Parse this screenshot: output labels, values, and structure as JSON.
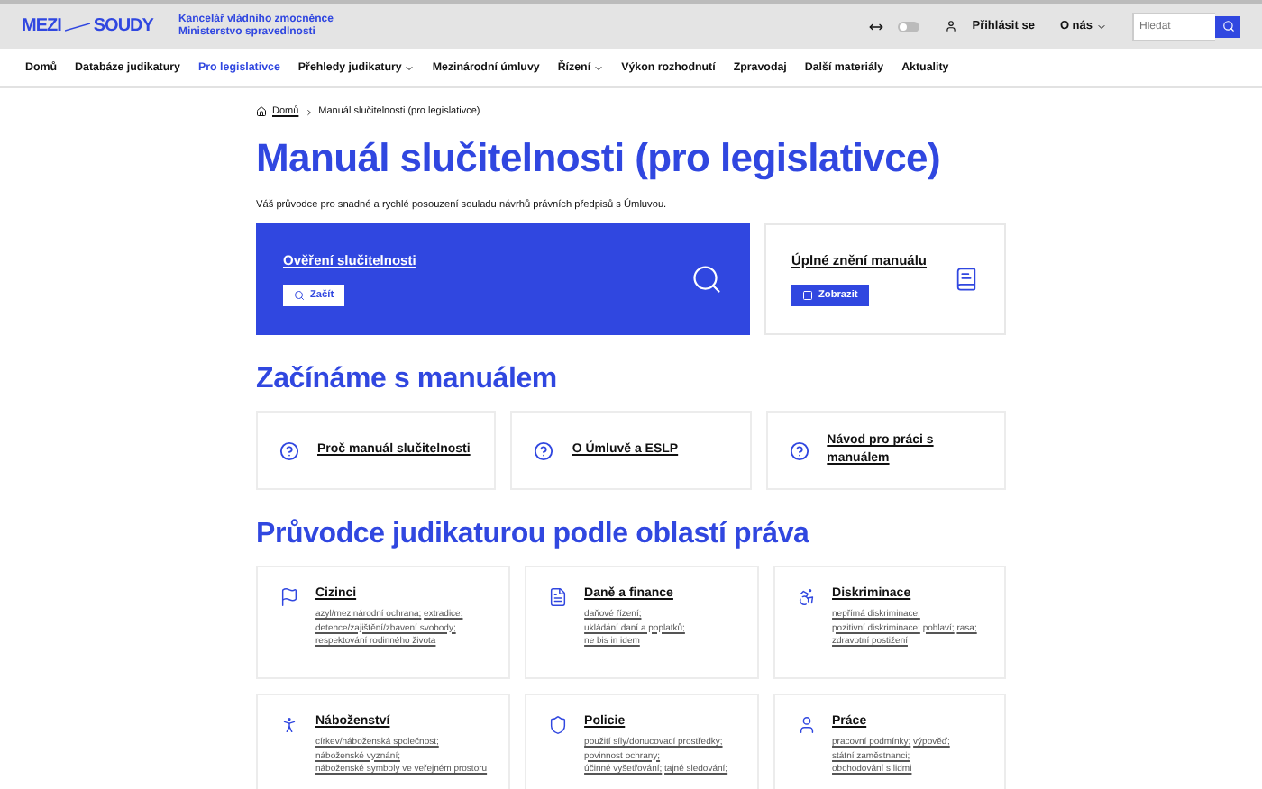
{
  "header": {
    "logo_left": "MEZI",
    "logo_right": "SOUDY",
    "org_lines": [
      "Kancelář vládního zmocněnce",
      "Ministerstvo spravedlnosti"
    ],
    "contrast_toggle": {
      "on": false
    },
    "login": "Přihlásit se",
    "about": "O nás",
    "search": {
      "placeholder": "Hledat"
    }
  },
  "nav": [
    {
      "label": "Domů",
      "selected": false,
      "has_menu": false
    },
    {
      "label": "Databáze judikatury",
      "selected": false,
      "has_menu": false
    },
    {
      "label": "Pro legislativce",
      "selected": true,
      "has_menu": false
    },
    {
      "label": "Přehledy judikatury",
      "selected": false,
      "has_menu": true
    },
    {
      "label": "Mezinárodní úmluvy",
      "selected": false,
      "has_menu": false
    },
    {
      "label": "Řízení",
      "selected": false,
      "has_menu": true
    },
    {
      "label": "Výkon rozhodnutí",
      "selected": false,
      "has_menu": false
    },
    {
      "label": "Zpravodaj",
      "selected": false,
      "has_menu": false
    },
    {
      "label": "Další materiály",
      "selected": false,
      "has_menu": false
    },
    {
      "label": "Aktuality",
      "selected": false,
      "has_menu": false
    }
  ],
  "breadcrumb": [
    "Domů",
    "Manuál slučitelnosti (pro legislativce)"
  ],
  "title": "Manuál slučitelnosti (pro legislativce)",
  "intro": "Váš průvodce pro snadné a rychlé posouzení souladu návrhů právních předpisů s Úmluvou.",
  "hero_cards": [
    {
      "kind": "primary",
      "title": "Ověření slučitelnosti",
      "button": "Začít"
    },
    {
      "kind": "secondary",
      "title": "Úplné znění manuálu",
      "button": "Zobrazit"
    }
  ],
  "start_heading": "Začínáme s manuálem",
  "start_links": [
    "Proč manuál slučitelnosti",
    "O Úmluvě a ESLP",
    "Návod pro práci s manuálem"
  ],
  "guide_heading": "Průvodce judikaturou podle oblastí práva",
  "topics": [
    {
      "title": "Cizinci",
      "links": [
        "azyl/mezinárodní ochrana;",
        "extradice;",
        "detence/zajištění/zbavení svobody;",
        "respektování rodinného života"
      ]
    },
    {
      "title": "Daně a finance",
      "links": [
        "daňové řízení;",
        "ukládání daní a poplatků;",
        "ne bis in idem"
      ]
    },
    {
      "title": "Diskriminace",
      "links": [
        "nepřímá diskriminace;",
        "pozitivní diskriminace;",
        "pohlaví;",
        "rasa;",
        "zdravotní postižení"
      ]
    },
    {
      "title": "Náboženství",
      "links": [
        "církev/náboženská společnost;",
        "náboženské vyznání;",
        "náboženské symboly ve veřejném prostoru"
      ]
    },
    {
      "title": "Policie",
      "links": [
        "použití síly/donucovací prostředky;",
        "povinnost ochrany;",
        "účinné vyšetřování;",
        "tajné sledování;"
      ]
    },
    {
      "title": "Práce",
      "links": [
        "pracovní podmínky;",
        "výpověď;",
        "státní zaměstnanci;",
        "obchodování s lidmi"
      ]
    }
  ]
}
